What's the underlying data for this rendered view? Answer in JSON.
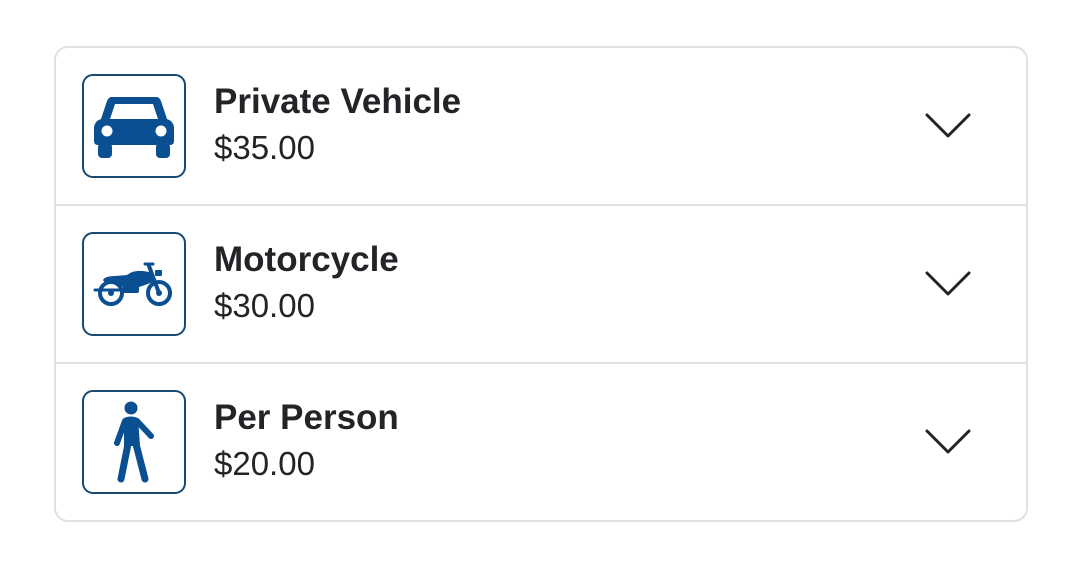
{
  "fees": [
    {
      "label": "Private Vehicle",
      "price": "$35.00",
      "icon": "car-icon"
    },
    {
      "label": "Motorcycle",
      "price": "$30.00",
      "icon": "motorcycle-icon"
    },
    {
      "label": "Per Person",
      "price": "$20.00",
      "icon": "pedestrian-icon"
    }
  ],
  "colors": {
    "icon_fill": "#0a4f92",
    "icon_border": "#174a73",
    "text": "#222427",
    "divider": "#e0e0e0"
  }
}
